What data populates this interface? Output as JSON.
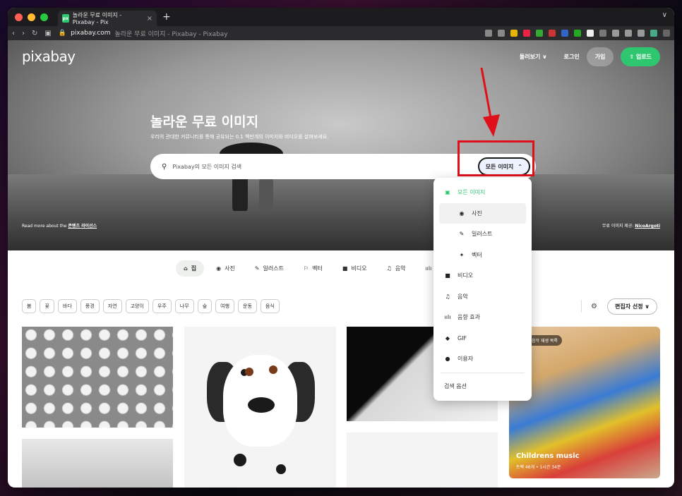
{
  "browser": {
    "tab_title": "놀라운 무료 이미지 - Pixabay - Pix",
    "favicon": "px",
    "new_tab": "+",
    "url_domain": "pixabay.com",
    "url_rest": "놀라운 무료 이미지 - Pixabay - Pixabay"
  },
  "header": {
    "logo": "pixabay",
    "explore": "둘러보기 ∨",
    "login": "로그인",
    "join": "가입",
    "upload": "⇧ 업로드"
  },
  "hero": {
    "title": "놀라운 무료 이미지",
    "subtitle": "우리의 관대한 커뮤니티를 통해 공유되는 0.1 백만개의 이미지와 비디오를 살펴보세요.",
    "search_placeholder": "Pixabay의 모든 이미지 검색",
    "type_button": "모든 이미지",
    "license_prefix": "Read more about the",
    "license_link": "콘텐츠 라이선스",
    "credit_prefix": "무료 이미지 제공:",
    "credit_name": "NicoArgoti"
  },
  "categories": [
    {
      "icon": "⌂",
      "label": "집"
    },
    {
      "icon": "◉",
      "label": "사진"
    },
    {
      "icon": "✎",
      "label": "일러스트"
    },
    {
      "icon": "⚐",
      "label": "벡터"
    },
    {
      "icon": "■",
      "label": "비디오"
    },
    {
      "icon": "♫",
      "label": "음악"
    },
    {
      "icon": "ıılı",
      "label": ""
    }
  ],
  "chips": [
    "봄",
    "꽃",
    "바다",
    "풍경",
    "자연",
    "고양이",
    "우주",
    "나무",
    "숲",
    "여행",
    "운동",
    "음식"
  ],
  "editor_select": "편집자 선정 ∨",
  "featured": {
    "badge": "음악 재생 목록",
    "title": "Childrens music",
    "meta": "트랙 46개 • 1시간 34분"
  },
  "dropdown": {
    "items": [
      {
        "icon": "▣",
        "label": "모든 이미지",
        "active": true
      },
      {
        "icon": "◉",
        "label": "사진",
        "sub": true,
        "hover": true
      },
      {
        "icon": "✎",
        "label": "일러스트",
        "sub": true
      },
      {
        "icon": "✦",
        "label": "벡터",
        "sub": true
      },
      {
        "icon": "■",
        "label": "비디오"
      },
      {
        "icon": "♫",
        "label": "음악"
      },
      {
        "icon": "ıılı",
        "label": "음향 효과"
      },
      {
        "icon": "◆",
        "label": "GIF"
      },
      {
        "icon": "●",
        "label": "이용자"
      }
    ],
    "options": "검색 옵션"
  },
  "colors": {
    "brand_green": "#2ec66e",
    "annotation_red": "#e0101a"
  }
}
